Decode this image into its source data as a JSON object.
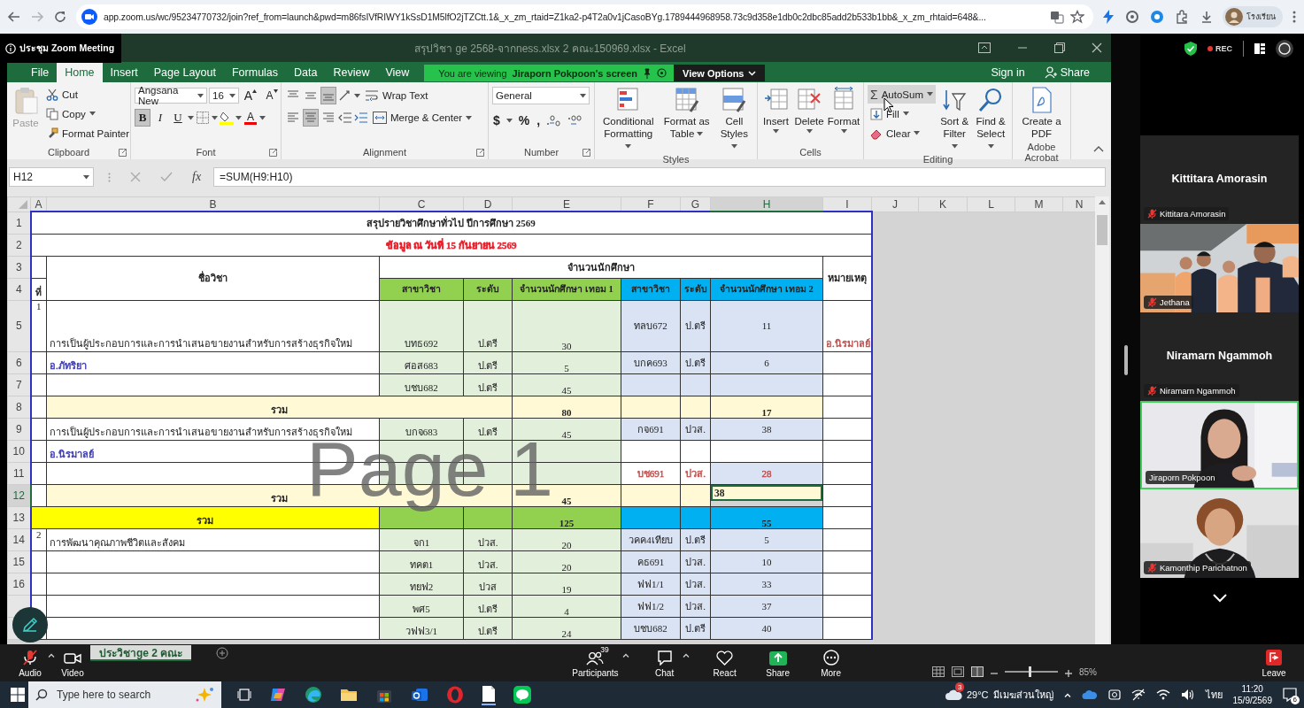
{
  "browser": {
    "url": "app.zoom.us/wc/95234770732/join?ref_from=launch&pwd=m86fsIVfRIWY1kSsD1M5lfO2jTZCtt.1&_x_zm_rtaid=Z1ka2-p4T2a0v1jCasoBYg.1789444968958.73c9d358e1db0c2dbc85add2b533b1bb&_x_zm_rhtaid=648&...",
    "profile_name": "โรงเรียน"
  },
  "meeting": {
    "title": "ประชุม Zoom Meeting",
    "rec_label": "REC"
  },
  "excel": {
    "title": "สรุปวิชา ge 2568-จากness.xlsx 2 คณะ150969.xlsx - Excel",
    "tabs": [
      {
        "label": "File",
        "selected": false
      },
      {
        "label": "Home",
        "selected": true
      },
      {
        "label": "Insert",
        "selected": false
      },
      {
        "label": "Page Layout",
        "selected": false
      },
      {
        "label": "Formulas",
        "selected": false
      },
      {
        "label": "Data",
        "selected": false
      },
      {
        "label": "Review",
        "selected": false
      },
      {
        "label": "View",
        "selected": false
      }
    ],
    "viewing_banner": {
      "prefix": "You are viewing",
      "owner": "Jiraporn Pokpoon's screen",
      "button": "View Options"
    },
    "sign_in": "Sign in",
    "share": "Share",
    "ribbon": [
      {
        "kind": "clipboard",
        "label": "Clipboard",
        "items": [
          {
            "label": "Paste",
            "disabled": true
          },
          {
            "label": "Cut",
            "disabled": false
          },
          {
            "label": "Copy",
            "disabled": false
          },
          {
            "label": "Format Painter",
            "disabled": false
          }
        ]
      },
      {
        "kind": "font",
        "label": "Font",
        "font": "Angsana New",
        "size": "16",
        "grow": "A",
        "shrink": "A",
        "styles": [
          {
            "label": "B",
            "selected": true
          },
          {
            "label": "I",
            "selected": false
          },
          {
            "label": "U",
            "selected": false
          }
        ],
        "font_color_glyph": "A"
      },
      {
        "kind": "alignment",
        "label": "Alignment",
        "vertical": [
          {
            "selected": false
          },
          {
            "selected": false
          },
          {
            "selected": true
          }
        ],
        "horizontal": [
          {
            "selected": false
          },
          {
            "selected": true
          },
          {
            "selected": false
          }
        ],
        "wrap": "Wrap Text",
        "merge": "Merge & Center"
      },
      {
        "kind": "number",
        "label": "Number",
        "format": "General",
        "symbols": [
          "$",
          "%",
          ","
        ]
      },
      {
        "kind": "styles",
        "label": "Styles",
        "items": [
          "Conditional Formatting",
          "Format as Table",
          "Cell Styles"
        ]
      },
      {
        "kind": "cells",
        "label": "Cells",
        "items": [
          "Insert",
          "Delete",
          "Format"
        ]
      },
      {
        "kind": "editing",
        "label": "Editing",
        "autosum": {
          "symbol": "Σ",
          "label": "AutoSum",
          "highlighted": true
        },
        "fill": "Fill",
        "clear": "Clear",
        "items": [
          "Sort & Filter",
          "Find & Select"
        ]
      },
      {
        "kind": "acrobat",
        "label": "Adobe Acrobat",
        "items": [
          "Create a PDF"
        ]
      }
    ],
    "name_box": "H12",
    "fx": "fx",
    "formula": "=SUM(H9:H10)",
    "columns": [
      {
        "label": "A",
        "selected": false
      },
      {
        "label": "B",
        "selected": false
      },
      {
        "label": "C",
        "selected": false
      },
      {
        "label": "D",
        "selected": false
      },
      {
        "label": "E",
        "selected": false
      },
      {
        "label": "F",
        "selected": false
      },
      {
        "label": "G",
        "selected": false
      },
      {
        "label": "H",
        "selected": true
      },
      {
        "label": "I",
        "selected": false
      },
      {
        "label": "J",
        "selected": false
      },
      {
        "label": "K",
        "selected": false
      },
      {
        "label": "L",
        "selected": false
      },
      {
        "label": "M",
        "selected": false
      },
      {
        "label": "N",
        "selected": false
      }
    ],
    "rows": [
      {
        "number": "1",
        "kind": "title",
        "selected": false,
        "cells": [
          {
            "text": "สรุปรายวิชาศึกษาทั่วไป ปีการศึกษา 2569",
            "colspan": 9,
            "selected": false
          }
        ]
      },
      {
        "number": "2",
        "kind": "subtitle",
        "selected": false,
        "cells": [
          {
            "text": "ข้อมูล ณ วันที่ 15 กันยายน 2569",
            "colspan": 9,
            "color": "#e8232e",
            "selected": false
          }
        ]
      },
      {
        "number": "3",
        "kind": "header-top",
        "selected": false,
        "cells": [
          {
            "selected": false
          },
          {
            "text": "ชื่อวิชา",
            "rowspan": 2,
            "selected": false
          },
          {
            "text": "จำนวนนักศึกษา",
            "colspan": 6,
            "selected": false
          },
          {
            "text": "หมายเหตุ",
            "rowspan": 2,
            "selected": false
          }
        ]
      },
      {
        "number": "4",
        "kind": "header",
        "selected": false,
        "cells": [
          {
            "text": "ที่",
            "selected": false
          },
          {
            "text": "สาขาวิชา",
            "selected": false
          },
          {
            "text": "ระดับ",
            "selected": false
          },
          {
            "text": "จำนวนนักศึกษา เทอม 1",
            "selected": false
          },
          {
            "text": "สาขาวิชา",
            "selected": false
          },
          {
            "text": "ระดับ",
            "selected": false
          },
          {
            "text": "จำนวนนักศึกษา เทอม 2",
            "selected": false
          }
        ]
      },
      {
        "number": "5",
        "kind": "data",
        "selected": false,
        "tall": true,
        "cells": [
          {
            "text": "1",
            "selected": false
          },
          {
            "text": "การเป็นผู้ประกอบการและการนำเสนอขายงานสำหรับการสร้างธุรกิจใหม่",
            "selected": false
          },
          {
            "text": "บทธ692",
            "selected": false
          },
          {
            "text": "ป.ตรี",
            "selected": false
          },
          {
            "text": "30",
            "selected": false
          },
          {
            "text": "ทลบ672",
            "selected": false
          },
          {
            "text": "ป.ตรี",
            "selected": false
          },
          {
            "text": "11",
            "selected": false
          },
          {
            "text": "อ.นิรมาลย์",
            "color": "#c0504d",
            "selected": false
          }
        ]
      },
      {
        "number": "6",
        "kind": "data",
        "selected": false,
        "cells": [
          {
            "selected": false
          },
          {
            "text": "อ.ภัทริยา",
            "color": "#3b3bb0",
            "selected": false
          },
          {
            "text": "ศอส683",
            "selected": false
          },
          {
            "text": "ป.ตรี",
            "selected": false
          },
          {
            "text": "5",
            "selected": false
          },
          {
            "text": "บกค693",
            "selected": false
          },
          {
            "text": "ป.ตรี",
            "selected": false
          },
          {
            "text": "6",
            "selected": false
          },
          {
            "selected": false
          }
        ]
      },
      {
        "number": "7",
        "kind": "data",
        "selected": false,
        "cells": [
          {
            "selected": false
          },
          {
            "selected": false
          },
          {
            "text": "บชบ682",
            "selected": false
          },
          {
            "text": "ป.ตรี",
            "selected": false
          },
          {
            "text": "45",
            "selected": false
          },
          {
            "selected": false
          },
          {
            "selected": false
          },
          {
            "selected": false
          },
          {
            "selected": false
          }
        ]
      },
      {
        "number": "8",
        "kind": "subtotal",
        "selected": false,
        "cells": [
          {
            "selected": false
          },
          {
            "text": "รวม",
            "colspan": 3,
            "selected": false
          },
          {
            "text": "80",
            "selected": false
          },
          {
            "selected": false
          },
          {
            "selected": false
          },
          {
            "text": "17",
            "selected": false
          },
          {
            "selected": false
          }
        ]
      },
      {
        "number": "9",
        "kind": "data",
        "selected": false,
        "cells": [
          {
            "selected": false
          },
          {
            "text": "การเป็นผู้ประกอบการและการนำเสนอขายงานสำหรับการสร้างธุรกิจใหม่",
            "selected": false
          },
          {
            "text": "บกจ683",
            "selected": false
          },
          {
            "text": "ป.ตรี",
            "selected": false
          },
          {
            "text": "45",
            "selected": false
          },
          {
            "text": "กจ691",
            "selected": false
          },
          {
            "text": "ปวส.",
            "selected": false
          },
          {
            "text": "38",
            "selected": false
          },
          {
            "selected": false
          }
        ]
      },
      {
        "number": "10",
        "kind": "data",
        "selected": false,
        "cells": [
          {
            "selected": false
          },
          {
            "text": "อ.นิรมาลย์",
            "color": "#3b3bb0",
            "selected": false
          },
          {
            "selected": false
          },
          {
            "selected": false
          },
          {
            "selected": false
          },
          {
            "plain": true,
            "selected": false
          },
          {
            "plain": true,
            "selected": false
          },
          {
            "plain": true,
            "selected": false
          },
          {
            "selected": false
          }
        ]
      },
      {
        "number": "11",
        "kind": "data",
        "selected": false,
        "cells": [
          {
            "selected": false
          },
          {
            "selected": false
          },
          {
            "selected": false
          },
          {
            "selected": false
          },
          {
            "selected": false
          },
          {
            "text": "บช691",
            "color": "#c0504d",
            "plain": true,
            "selected": false
          },
          {
            "text": "ปวส.",
            "color": "#c0504d",
            "plain": true,
            "selected": false
          },
          {
            "text": "28",
            "color": "#c0504d",
            "selected": false
          },
          {
            "selected": false
          }
        ]
      },
      {
        "number": "12",
        "kind": "subtotal",
        "selected": true,
        "cells": [
          {
            "selected": false
          },
          {
            "text": "รวม",
            "colspan": 3,
            "selected": false
          },
          {
            "text": "45",
            "selected": false
          },
          {
            "selected": false
          },
          {
            "selected": false
          },
          {
            "text": "38",
            "selected": true
          },
          {
            "selected": false
          }
        ]
      },
      {
        "number": "13",
        "kind": "total",
        "selected": false,
        "cells": [
          {
            "text": "รวม",
            "colspan": 2,
            "selected": false
          },
          {
            "selected": false
          },
          {
            "selected": false
          },
          {
            "text": "125",
            "selected": false
          },
          {
            "selected": false
          },
          {
            "selected": false
          },
          {
            "text": "55",
            "selected": false
          },
          {
            "selected": false
          }
        ]
      },
      {
        "number": "14",
        "kind": "data",
        "selected": false,
        "cells": [
          {
            "text": "2",
            "selected": false
          },
          {
            "text": "การพัฒนาคุณภาพชีวิตและสังคม",
            "selected": false
          },
          {
            "text": "จก1",
            "selected": false
          },
          {
            "text": "ปวส.",
            "selected": false
          },
          {
            "text": "20",
            "selected": false
          },
          {
            "text": "วคค4เทียบ",
            "selected": false
          },
          {
            "text": "ป.ตรี",
            "selected": false
          },
          {
            "text": "5",
            "selected": false
          },
          {
            "selected": false
          }
        ]
      },
      {
        "number": "15",
        "kind": "data",
        "selected": false,
        "cells": [
          {
            "selected": false
          },
          {
            "selected": false
          },
          {
            "text": "ทคต1",
            "selected": false
          },
          {
            "text": "ปวส.",
            "selected": false
          },
          {
            "text": "20",
            "selected": false
          },
          {
            "text": "คธ691",
            "selected": false
          },
          {
            "text": "ปวส.",
            "selected": false
          },
          {
            "text": "10",
            "selected": false
          },
          {
            "selected": false
          }
        ]
      },
      {
        "number": "16",
        "kind": "data",
        "selected": false,
        "cells": [
          {
            "selected": false
          },
          {
            "selected": false
          },
          {
            "text": "ทยฟ2",
            "selected": false
          },
          {
            "text": "ปวส",
            "selected": false
          },
          {
            "text": "19",
            "selected": false
          },
          {
            "text": "ฟฟ1/1",
            "selected": false
          },
          {
            "text": "ปวส.",
            "selected": false
          },
          {
            "text": "33",
            "selected": false
          },
          {
            "selected": false
          }
        ]
      },
      {
        "kind": "data",
        "selected": false,
        "cells": [
          {
            "selected": false
          },
          {
            "selected": false
          },
          {
            "text": "พศ5",
            "selected": false
          },
          {
            "text": "ป.ตรี",
            "selected": false
          },
          {
            "text": "4",
            "selected": false
          },
          {
            "text": "ฟฟ1/2",
            "selected": false
          },
          {
            "text": "ปวส.",
            "selected": false
          },
          {
            "text": "37",
            "selected": false
          },
          {
            "selected": false
          }
        ]
      },
      {
        "kind": "data",
        "selected": false,
        "cells": [
          {
            "selected": false
          },
          {
            "selected": false
          },
          {
            "text": "วฟฟ3/1",
            "selected": false
          },
          {
            "text": "ป.ตรี",
            "selected": false
          },
          {
            "text": "24",
            "selected": false
          },
          {
            "text": "บชบ682",
            "selected": false
          },
          {
            "text": "ป.ตรี",
            "selected": false
          },
          {
            "text": "40",
            "selected": false
          },
          {
            "selected": false
          }
        ]
      }
    ],
    "page_label": "Page 1",
    "sheet_tab": "ประวิชาge 2 คณะ"
  },
  "participants": [
    {
      "kind": "name",
      "name": "Kittitara Amorasin",
      "label": "Kittitara Amorasin",
      "muted": true,
      "speaking": false
    },
    {
      "kind": "video",
      "label": "Jethana",
      "muted": true,
      "speaking": false
    },
    {
      "kind": "name",
      "name": "Niramarn Ngammoh",
      "label": "Niramarn Ngammoh",
      "muted": true,
      "speaking": false
    },
    {
      "kind": "video",
      "label": "Jiraporn Pokpoon",
      "muted": false,
      "speaking": true
    },
    {
      "kind": "video",
      "label": "Kamonthip Parichatnon",
      "muted": true,
      "speaking": false
    }
  ],
  "toolbar": {
    "left": [
      {
        "kind": "audio",
        "label": "Audio",
        "muted": true
      },
      {
        "kind": "video",
        "label": "Video",
        "muted": false
      }
    ],
    "center": [
      {
        "kind": "participants",
        "label": "Participants",
        "count": "39"
      },
      {
        "kind": "chat",
        "label": "Chat"
      },
      {
        "kind": "react",
        "label": "React"
      },
      {
        "kind": "share",
        "label": "Share"
      },
      {
        "kind": "more",
        "label": "More"
      }
    ],
    "leave": "Leave",
    "zoom_level": "85%",
    "zoom_slider": {
      "level": 0.45
    }
  },
  "taskbar": {
    "search_placeholder": "Type here to search",
    "weather_badge": "3",
    "temperature": "29°C",
    "weather": "มีเมฆส่วนใหญ่",
    "language": "ไทย",
    "time": "11:20",
    "date": "15/9/2569",
    "notifications": "6"
  }
}
